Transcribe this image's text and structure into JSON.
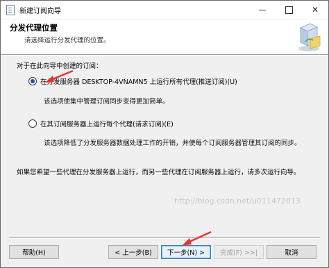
{
  "window": {
    "title": "新建订阅向导",
    "minimize": "─",
    "maximize": "□",
    "close": "✕"
  },
  "header": {
    "title": "分发代理位置",
    "subtitle": "请选择运行分发代理的位置。"
  },
  "content": {
    "prompt": "对于在此向导中创建的订阅：",
    "option1_label": "在分发服务器 DESKTOP-4VNAMN5 上运行所有代理(推送订阅)(U)",
    "option1_desc": "该选项使集中管理订阅同步变得更加简单。",
    "option2_label": "在其订阅服务器上运行每个代理(请求订阅)(E)",
    "option2_desc": "该选项降低了分发服务器数据处理工作的开销，并使每个订阅服务器管理其订阅的同步。",
    "note": "如果您希望一些代理在分发服务器上运行，而另一些代理在订阅服务器上运行，请多次运行向导。",
    "selected_option": 1
  },
  "buttons": {
    "help": "帮助(H)",
    "back": "< 上一步(B)",
    "next": "下一步(N) >",
    "finish": "完成(F) >>|",
    "cancel": "取消"
  },
  "watermark": "http://blog.csdn.net/u011472013",
  "colors": {
    "annotation_arrow": "#e8312a"
  }
}
